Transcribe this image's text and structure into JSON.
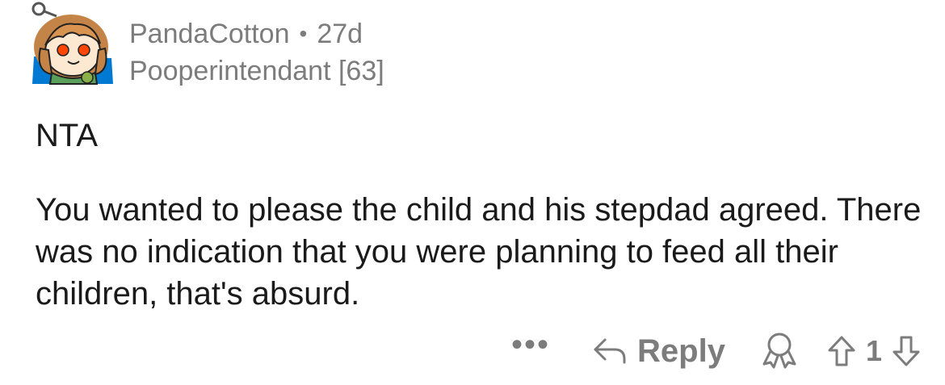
{
  "comment": {
    "username": "PandaCotton",
    "separator": "•",
    "age": "27d",
    "flair": "Pooperintendant [63]",
    "paragraphs": [
      "NTA",
      "You wanted to please the child and his stepdad agreed. There was no indication that you were planning to feed all their children, that's absurd."
    ]
  },
  "actions": {
    "more_label": "•••",
    "reply_label": "Reply",
    "score": "1"
  },
  "icons": {
    "avatar": "snoo-avatar",
    "reply": "reply-arrow-icon",
    "award": "award-icon",
    "upvote": "upvote-arrow-icon",
    "downvote": "downvote-arrow-icon"
  },
  "colors": {
    "text": "#1a1a1b",
    "meta": "#7c7c7c",
    "avatar_bg": "#0079d3"
  }
}
